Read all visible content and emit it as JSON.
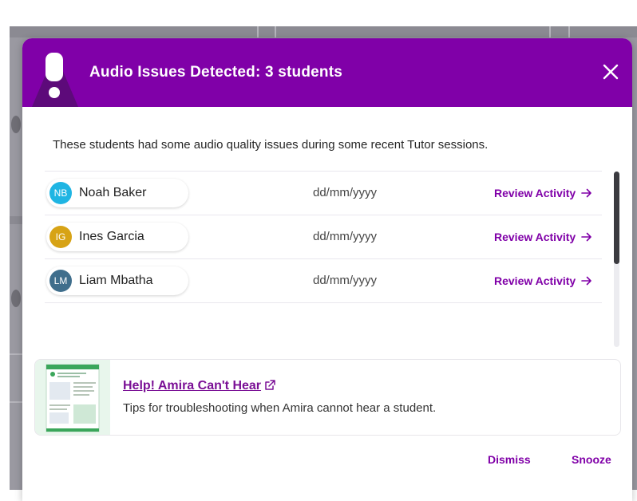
{
  "modal": {
    "title": "Audio Issues Detected: 3 students",
    "intro": "These students had some audio quality issues during some recent Tutor sessions.",
    "header_icon": "exclamation-icon",
    "close_icon": "close-icon"
  },
  "students": [
    {
      "initials": "NB",
      "name": "Noah Baker",
      "date": "dd/mm/yyyy",
      "action": "Review Activity",
      "avatar_color": "#1fb5e3"
    },
    {
      "initials": "IG",
      "name": "Ines Garcia",
      "date": "dd/mm/yyyy",
      "action": "Review Activity",
      "avatar_color": "#d7a316"
    },
    {
      "initials": "LM",
      "name": "Liam Mbatha",
      "date": "dd/mm/yyyy",
      "action": "Review Activity",
      "avatar_color": "#3f6e8c"
    }
  ],
  "resource": {
    "title": "Help! Amira Can't Hear",
    "description": "Tips for troubleshooting when Amira cannot hear a student.",
    "icon": "external-link-icon"
  },
  "footer": {
    "dismiss_label": "Dismiss",
    "snooze_label": "Snooze"
  },
  "colors": {
    "accent": "#8000a8",
    "header_bg": "#8000a8"
  }
}
